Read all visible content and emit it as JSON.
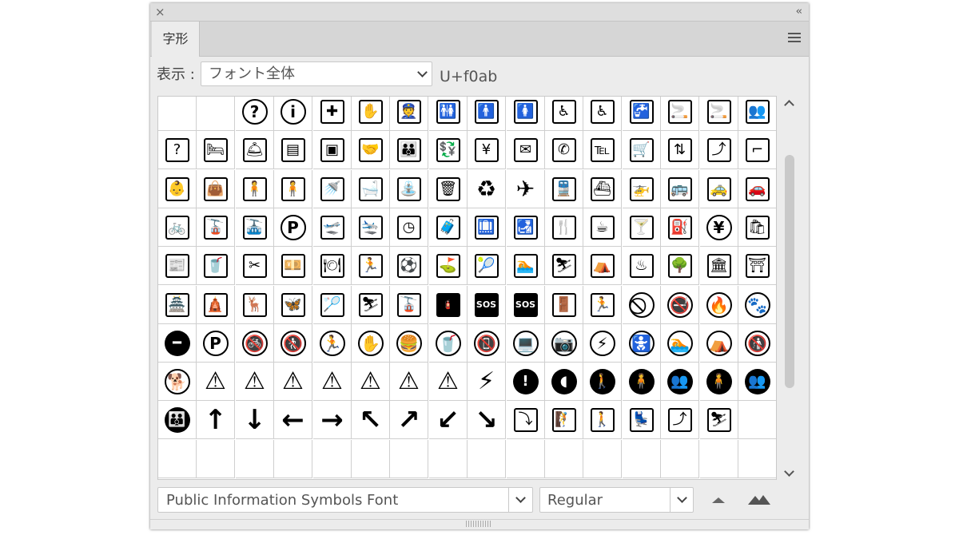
{
  "panel": {
    "close_glyph": "×",
    "collapse_glyph": "‹‹",
    "tab_label": "字形",
    "show_label": "表示 :",
    "show_value": "フォント全体",
    "unicode_value": "U+f0ab"
  },
  "footer": {
    "font_name": "Public Information Symbols Font",
    "font_style": "Regular"
  },
  "icons": {
    "close": "close-icon",
    "collapse": "double-chevron-left-icon",
    "menu": "hamburger-menu-icon",
    "dropdown": "chevron-down-icon",
    "zoom_out": "small-mountain-zoom-out-icon",
    "zoom_in": "large-mountain-zoom-in-icon"
  },
  "colors": {
    "panel_bg": "#ececec",
    "grid_bg": "#ffffff",
    "glyph": "#000000"
  },
  "glyph_grid": {
    "columns": 16,
    "rows": [
      [
        "",
        "",
        "question",
        "information",
        "first-aid",
        "stop-hand",
        "police",
        "toilets",
        "men",
        "women",
        "wheelchair",
        "wheelchair-ramp",
        "drinking-water",
        "smoking",
        "smoking-area",
        "meeting-point"
      ],
      [
        "information-desk",
        "bed",
        "reception",
        "lockers",
        "coin-locker",
        "handshake",
        "family",
        "currency-exchange",
        "ticket-machine",
        "mail",
        "telephone",
        "fax",
        "baggage-cart",
        "elevator",
        "escalator",
        "stairs"
      ],
      [
        "baby-change",
        "cloakroom-bag",
        "cloakroom-man",
        "cloakroom-woman",
        "shower",
        "bath",
        "drinking-fountain",
        "trash-bin",
        "recycle",
        "airplane",
        "train",
        "ship",
        "helicopter",
        "bus",
        "taxi",
        "car-rental"
      ],
      [
        "bicycle",
        "ropeway",
        "cable-car",
        "parking",
        "departures",
        "arrivals",
        "transit",
        "baggage-claim",
        "check-in",
        "customs",
        "restaurant",
        "coffee",
        "bar",
        "fuel",
        "yen",
        "shopping"
      ],
      [
        "news",
        "vending",
        "barber",
        "cashier",
        "dining",
        "running",
        "football",
        "golf",
        "tennis",
        "swimming",
        "skiing",
        "camping",
        "hot-spring",
        "park",
        "museum",
        "temple"
      ],
      [
        "castle",
        "pagoda",
        "deer-park",
        "insect-net",
        "badminton",
        "ski-lift",
        "chair-lift",
        "fire-extinguisher",
        "sos-phone",
        "sos-button",
        "emergency-exit",
        "evacuation-area",
        "prohibited",
        "no-smoking",
        "no-fire",
        "no-pets"
      ],
      [
        "no-entry",
        "no-parking",
        "no-bicycles",
        "no-stopping",
        "no-running",
        "no-touching",
        "no-food",
        "no-drinking",
        "no-phones",
        "no-computers",
        "no-photography",
        "no-flash",
        "no-strollers",
        "no-swimming",
        "no-camping",
        "no-dumping"
      ],
      [
        "no-dogs",
        "caution",
        "slippery-warning",
        "falling-warning",
        "tripping-warning",
        "low-ceiling-warning",
        "step-warning",
        "fall-warning",
        "electric-warning",
        "mandatory",
        "hearing",
        "walking-mandatory",
        "queue-mandatory",
        "group-mandatory",
        "single-file",
        "crowd-mandatory"
      ],
      [
        "crowd",
        "arrow-up",
        "arrow-down",
        "arrow-left",
        "arrow-right",
        "arrow-up-left",
        "arrow-up-right",
        "arrow-down-left",
        "arrow-down-right",
        "falling-object-sign",
        "climbing-sign",
        "passenger-sign",
        "seat-sign",
        "escalator-sign",
        "slope-sign",
        ""
      ],
      [
        "",
        "",
        "",
        "",
        "",
        "",
        "",
        "",
        "",
        "",
        "",
        "",
        "",
        "",
        "",
        ""
      ]
    ]
  }
}
